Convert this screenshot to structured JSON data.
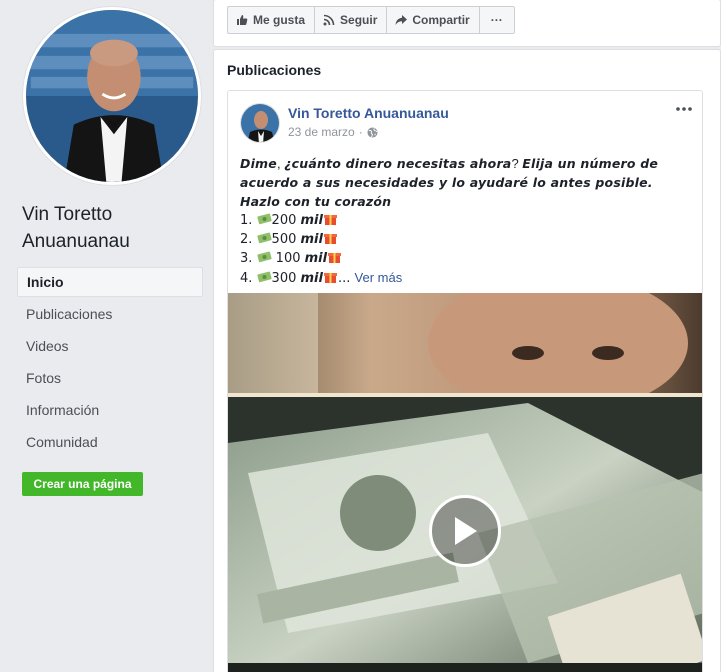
{
  "page": {
    "name": "Vin Toretto Anuanuanau"
  },
  "nav": {
    "items": [
      {
        "label": "Inicio",
        "active": true
      },
      {
        "label": "Publicaciones",
        "active": false
      },
      {
        "label": "Videos",
        "active": false
      },
      {
        "label": "Fotos",
        "active": false
      },
      {
        "label": "Información",
        "active": false
      },
      {
        "label": "Comunidad",
        "active": false
      }
    ],
    "create_page_label": "Crear una página"
  },
  "actions": {
    "like_label": "Me gusta",
    "follow_label": "Seguir",
    "share_label": "Compartir",
    "more_label": "···"
  },
  "posts": {
    "section_title": "Publicaciones",
    "post": {
      "author": "Vin Toretto Anuanuanau",
      "date": "23 de marzo",
      "date_separator": "·",
      "text_intro_1": "Dime",
      "text_intro_2": ", ",
      "text_intro_3": "¿cuánto dinero necesitas ahora",
      "text_intro_4": "? ",
      "text_intro_5": "Elija un número de acuerdo a sus necesidades y lo ayudaré lo antes posible. Hazlo con tu corazón",
      "list": [
        {
          "num": "1.",
          "amount": "200",
          "unit": "mil"
        },
        {
          "num": "2.",
          "amount": "500",
          "unit": "mil"
        },
        {
          "num": "3.",
          "amount": " 100",
          "unit": "mil"
        },
        {
          "num": "4.",
          "amount": "300",
          "unit": "mil"
        }
      ],
      "ellipsis": "...",
      "see_more": "Ver más"
    }
  },
  "colors": {
    "link": "#365899",
    "create_button": "#42b72a",
    "page_bg": "#e9ebee"
  },
  "icons": {
    "like": "thumbs-up-icon",
    "follow": "rss-icon",
    "share": "share-arrow-icon",
    "globe": "globe-icon",
    "play": "play-icon"
  }
}
